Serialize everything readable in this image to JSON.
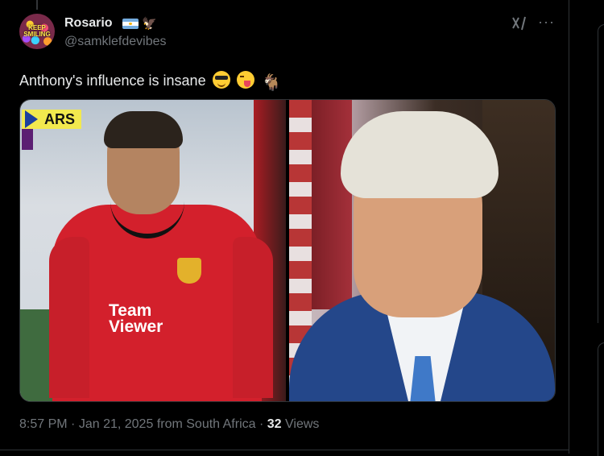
{
  "tweet": {
    "author": {
      "display_name": "Rosario",
      "handle": "@samklefdevibes",
      "avatar_text": "KEEP SMILING"
    },
    "text": "Anthony's influence is insane",
    "emojis": [
      "smiling-face-with-sunglasses",
      "winking-face-with-tongue",
      "goat"
    ],
    "media": {
      "overlay_tag": "ARS",
      "left_sponsor_line1": "Team",
      "left_sponsor_line2": "Viewer"
    },
    "meta": {
      "time": "8:57 PM",
      "date": "Jan 21, 2025",
      "location": "from South Africa",
      "views_count": "32",
      "views_label": "Views",
      "separator": "·"
    }
  },
  "icons": {
    "grok": "grok-icon",
    "more": "more-icon",
    "flag": "argentina-flag-icon",
    "eagle": "eagle-icon"
  },
  "colors": {
    "background": "#000000",
    "text_primary": "#e7e9ea",
    "text_secondary": "#71767b",
    "border": "#2f3336"
  }
}
